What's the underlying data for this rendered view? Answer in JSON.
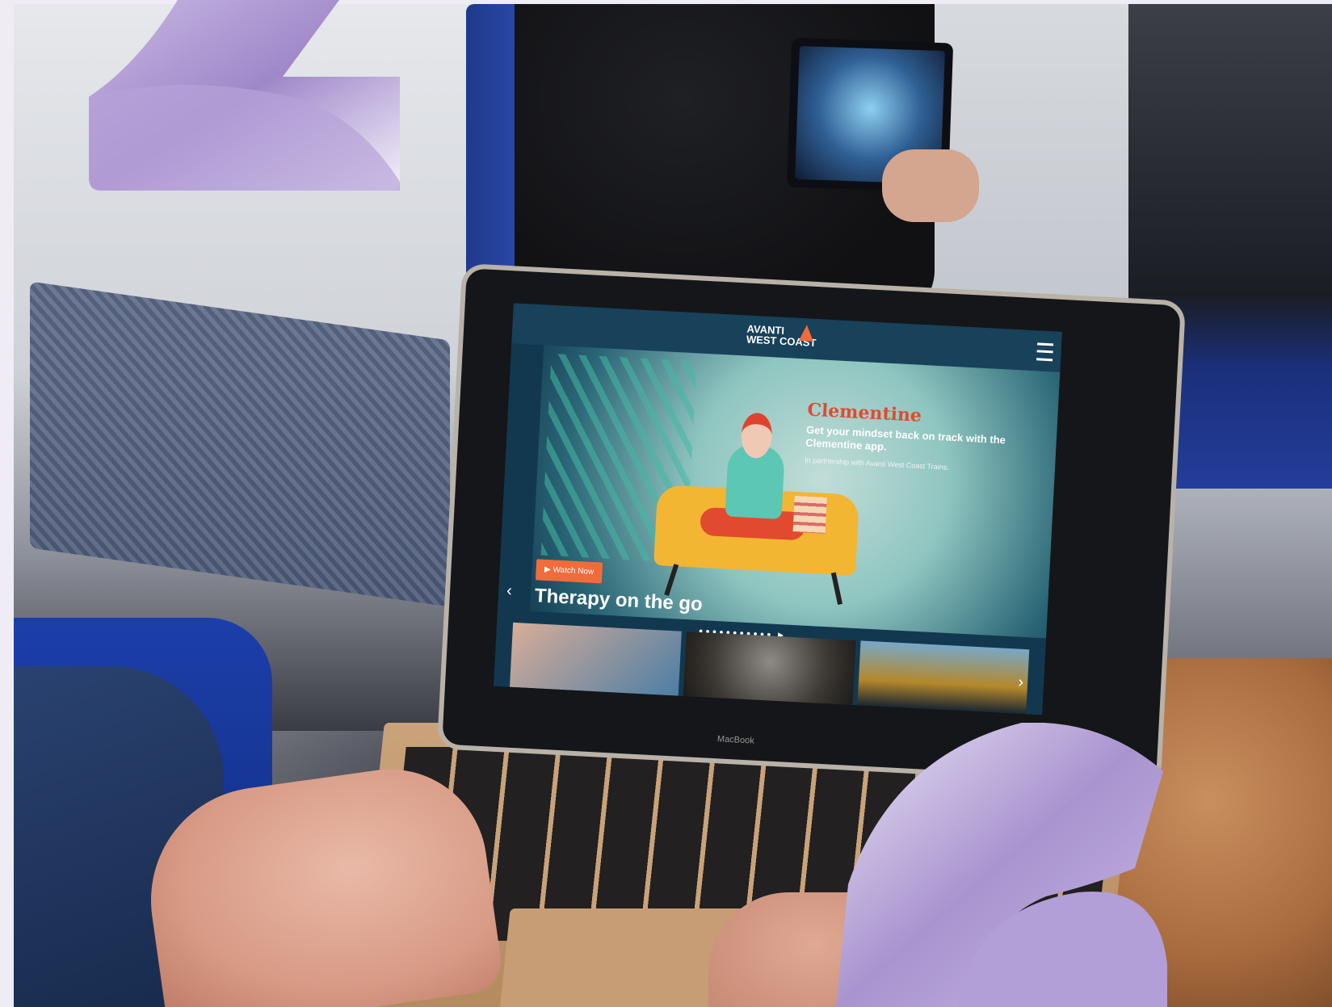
{
  "screen": {
    "brand_line1": "AVANTI",
    "brand_line2": "WEST COAST",
    "hero_title": "Clementine",
    "hero_subtitle": "Get your mindset back on track with the Clementine app.",
    "hero_note": "In partnership with Avanti West Coast Trains.",
    "watch_button": "▶ Watch Now",
    "headline": "Therapy on the go",
    "carousel_dots": "●●●●●●●●●●● ▶",
    "prev_arrow": "‹",
    "next_arrow": "›"
  },
  "laptop": {
    "brand": "MacBook"
  },
  "colors": {
    "accent_orange": "#f26b3a",
    "lavender": "#b7a4d6"
  }
}
